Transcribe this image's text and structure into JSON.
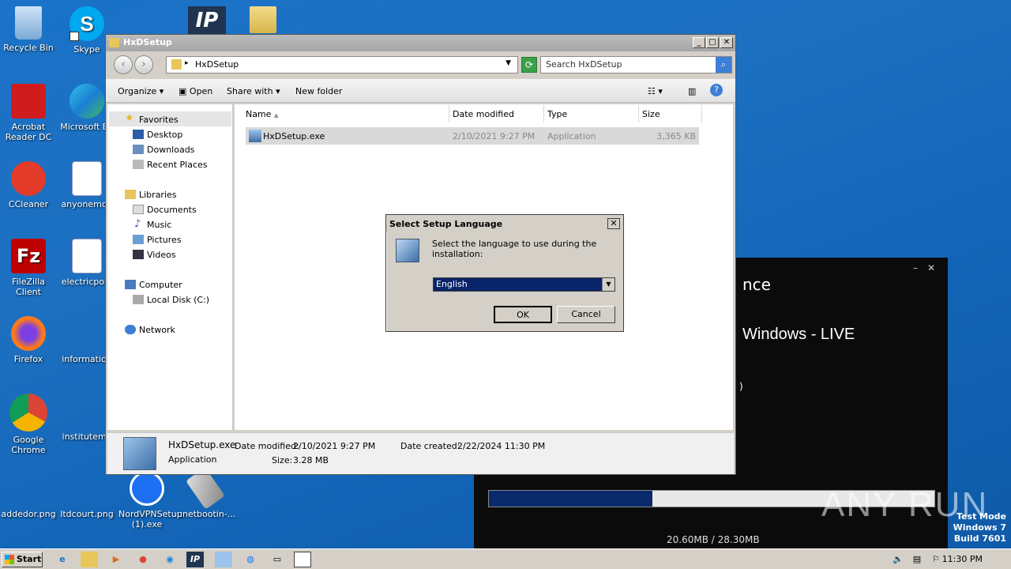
{
  "desktop": {
    "icons": [
      {
        "label": "Recycle Bin"
      },
      {
        "label": "Skype"
      },
      {
        "label": "Acrobat Reader DC"
      },
      {
        "label": "Microsoft Ed"
      },
      {
        "label": "CCleaner"
      },
      {
        "label": "anyonemod"
      },
      {
        "label": "FileZilla Client"
      },
      {
        "label": "electricpost"
      },
      {
        "label": "Firefox"
      },
      {
        "label": "information"
      },
      {
        "label": "Google Chrome"
      },
      {
        "label": "institutemo"
      },
      {
        "label": "addedor.png"
      },
      {
        "label": "ltdcourt.png"
      },
      {
        "label": "NordVPNSetup (1).exe"
      },
      {
        "label": "unetbootin-..."
      }
    ]
  },
  "media_window": {
    "title_fragment": "nce",
    "subtitle": "Windows - LIVE",
    "paren": ")",
    "progress": 0.367,
    "size_text": "20.60MB / 28.30MB"
  },
  "explorer": {
    "title": "HxDSetup",
    "address": "HxDSetup",
    "search_placeholder": "Search HxDSetup",
    "toolbar": {
      "organize": "Organize",
      "open": "Open",
      "share_with": "Share with",
      "new_folder": "New folder"
    },
    "nav": {
      "favorites": "Favorites",
      "desktop": "Desktop",
      "downloads": "Downloads",
      "recent": "Recent Places",
      "libraries": "Libraries",
      "documents": "Documents",
      "music": "Music",
      "pictures": "Pictures",
      "videos": "Videos",
      "computer": "Computer",
      "local_disk": "Local Disk (C:)",
      "network": "Network"
    },
    "columns": {
      "name": "Name",
      "date": "Date modified",
      "type": "Type",
      "size": "Size"
    },
    "files": [
      {
        "name": "HxDSetup.exe",
        "date": "2/10/2021 9:27 PM",
        "type": "Application",
        "size": "3,365 KB"
      }
    ],
    "details": {
      "name": "HxDSetup.exe",
      "kind": "Application",
      "modified_label": "Date modified:",
      "modified": "2/10/2021 9:27 PM",
      "created_label": "Date created:",
      "created": "2/22/2024 11:30 PM",
      "size_label": "Size:",
      "size": "3.28 MB"
    }
  },
  "dialog": {
    "title": "Select Setup Language",
    "message": "Select the language to use during the installation:",
    "selected_language": "English",
    "ok": "OK",
    "cancel": "Cancel"
  },
  "taskbar": {
    "start": "Start",
    "clock": "11:30 PM"
  },
  "overlay": {
    "test_mode": "Test Mode",
    "os": "Windows 7",
    "build": "Build 7601",
    "watermark": "ANY RUN"
  }
}
